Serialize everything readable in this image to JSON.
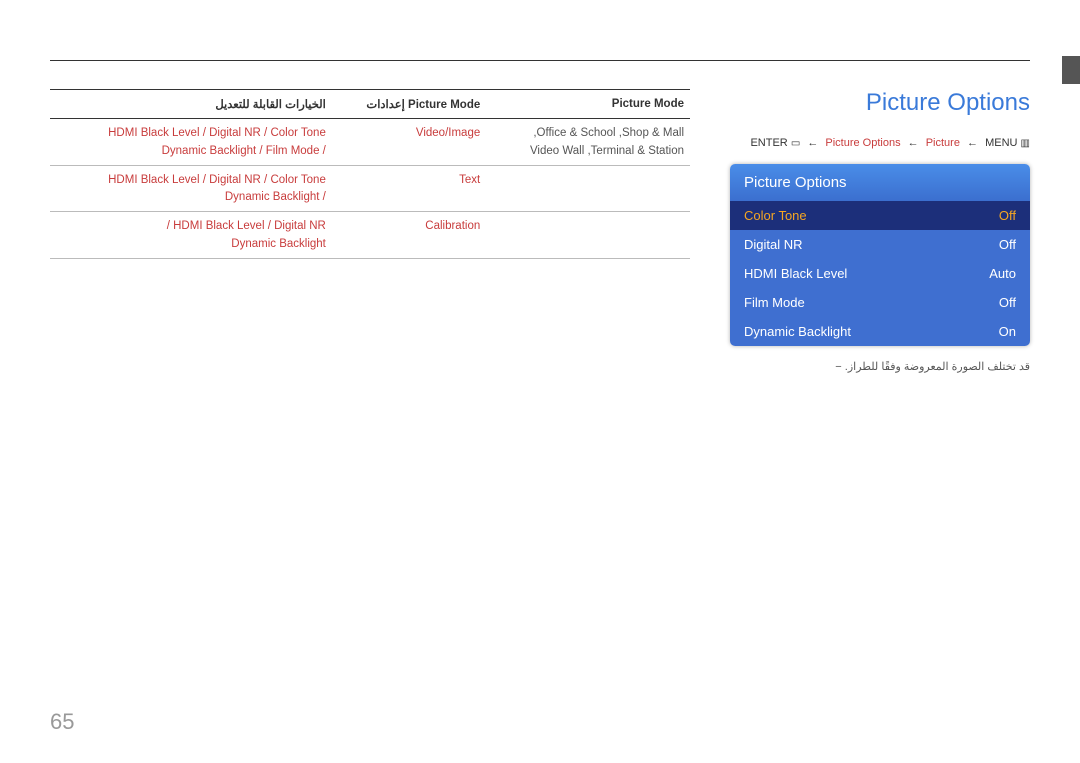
{
  "section_title": "Picture Options",
  "breadcrumb": {
    "enter": "ENTER",
    "item1": "Picture Options",
    "item2": "Picture",
    "menu": "MENU"
  },
  "osd": {
    "title": "Picture Options",
    "rows": [
      {
        "label": "Color Tone",
        "value": "Off",
        "selected": true
      },
      {
        "label": "Digital NR",
        "value": "Off",
        "selected": false
      },
      {
        "label": "HDMI Black Level",
        "value": "Auto",
        "selected": false
      },
      {
        "label": "Film Mode",
        "value": "Off",
        "selected": false
      },
      {
        "label": "Dynamic Backlight",
        "value": "On",
        "selected": false
      }
    ]
  },
  "note": "قد تختلف الصورة المعروضة وفقًا للطراز.   −",
  "table": {
    "headers": {
      "c1": "الخيارات القابلة للتعديل",
      "c2": "إعدادات Picture Mode",
      "c3": "Picture Mode"
    },
    "rows": [
      {
        "c1": "HDMI Black Level / Digital NR / Color Tone\nDynamic Backlight / Film Mode /",
        "c2": "Video/Image",
        "c3": ",Office & School ,Shop & Mall\nVideo Wall ,Terminal & Station"
      },
      {
        "c1": "HDMI Black Level / Digital NR / Color Tone\nDynamic Backlight /",
        "c2": "Text",
        "c3": ""
      },
      {
        "c1": "/ HDMI Black Level / Digital NR\nDynamic Backlight",
        "c2": "Calibration",
        "c3": ""
      }
    ]
  },
  "page_number": "65"
}
